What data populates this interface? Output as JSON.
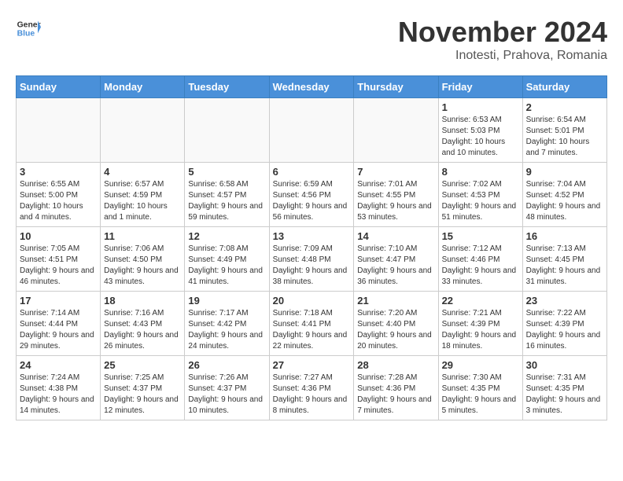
{
  "header": {
    "logo_general": "General",
    "logo_blue": "Blue",
    "month_title": "November 2024",
    "subtitle": "Inotesti, Prahova, Romania"
  },
  "weekdays": [
    "Sunday",
    "Monday",
    "Tuesday",
    "Wednesday",
    "Thursday",
    "Friday",
    "Saturday"
  ],
  "weeks": [
    [
      {
        "day": "",
        "info": ""
      },
      {
        "day": "",
        "info": ""
      },
      {
        "day": "",
        "info": ""
      },
      {
        "day": "",
        "info": ""
      },
      {
        "day": "",
        "info": ""
      },
      {
        "day": "1",
        "info": "Sunrise: 6:53 AM\nSunset: 5:03 PM\nDaylight: 10 hours and 10 minutes."
      },
      {
        "day": "2",
        "info": "Sunrise: 6:54 AM\nSunset: 5:01 PM\nDaylight: 10 hours and 7 minutes."
      }
    ],
    [
      {
        "day": "3",
        "info": "Sunrise: 6:55 AM\nSunset: 5:00 PM\nDaylight: 10 hours and 4 minutes."
      },
      {
        "day": "4",
        "info": "Sunrise: 6:57 AM\nSunset: 4:59 PM\nDaylight: 10 hours and 1 minute."
      },
      {
        "day": "5",
        "info": "Sunrise: 6:58 AM\nSunset: 4:57 PM\nDaylight: 9 hours and 59 minutes."
      },
      {
        "day": "6",
        "info": "Sunrise: 6:59 AM\nSunset: 4:56 PM\nDaylight: 9 hours and 56 minutes."
      },
      {
        "day": "7",
        "info": "Sunrise: 7:01 AM\nSunset: 4:55 PM\nDaylight: 9 hours and 53 minutes."
      },
      {
        "day": "8",
        "info": "Sunrise: 7:02 AM\nSunset: 4:53 PM\nDaylight: 9 hours and 51 minutes."
      },
      {
        "day": "9",
        "info": "Sunrise: 7:04 AM\nSunset: 4:52 PM\nDaylight: 9 hours and 48 minutes."
      }
    ],
    [
      {
        "day": "10",
        "info": "Sunrise: 7:05 AM\nSunset: 4:51 PM\nDaylight: 9 hours and 46 minutes."
      },
      {
        "day": "11",
        "info": "Sunrise: 7:06 AM\nSunset: 4:50 PM\nDaylight: 9 hours and 43 minutes."
      },
      {
        "day": "12",
        "info": "Sunrise: 7:08 AM\nSunset: 4:49 PM\nDaylight: 9 hours and 41 minutes."
      },
      {
        "day": "13",
        "info": "Sunrise: 7:09 AM\nSunset: 4:48 PM\nDaylight: 9 hours and 38 minutes."
      },
      {
        "day": "14",
        "info": "Sunrise: 7:10 AM\nSunset: 4:47 PM\nDaylight: 9 hours and 36 minutes."
      },
      {
        "day": "15",
        "info": "Sunrise: 7:12 AM\nSunset: 4:46 PM\nDaylight: 9 hours and 33 minutes."
      },
      {
        "day": "16",
        "info": "Sunrise: 7:13 AM\nSunset: 4:45 PM\nDaylight: 9 hours and 31 minutes."
      }
    ],
    [
      {
        "day": "17",
        "info": "Sunrise: 7:14 AM\nSunset: 4:44 PM\nDaylight: 9 hours and 29 minutes."
      },
      {
        "day": "18",
        "info": "Sunrise: 7:16 AM\nSunset: 4:43 PM\nDaylight: 9 hours and 26 minutes."
      },
      {
        "day": "19",
        "info": "Sunrise: 7:17 AM\nSunset: 4:42 PM\nDaylight: 9 hours and 24 minutes."
      },
      {
        "day": "20",
        "info": "Sunrise: 7:18 AM\nSunset: 4:41 PM\nDaylight: 9 hours and 22 minutes."
      },
      {
        "day": "21",
        "info": "Sunrise: 7:20 AM\nSunset: 4:40 PM\nDaylight: 9 hours and 20 minutes."
      },
      {
        "day": "22",
        "info": "Sunrise: 7:21 AM\nSunset: 4:39 PM\nDaylight: 9 hours and 18 minutes."
      },
      {
        "day": "23",
        "info": "Sunrise: 7:22 AM\nSunset: 4:39 PM\nDaylight: 9 hours and 16 minutes."
      }
    ],
    [
      {
        "day": "24",
        "info": "Sunrise: 7:24 AM\nSunset: 4:38 PM\nDaylight: 9 hours and 14 minutes."
      },
      {
        "day": "25",
        "info": "Sunrise: 7:25 AM\nSunset: 4:37 PM\nDaylight: 9 hours and 12 minutes."
      },
      {
        "day": "26",
        "info": "Sunrise: 7:26 AM\nSunset: 4:37 PM\nDaylight: 9 hours and 10 minutes."
      },
      {
        "day": "27",
        "info": "Sunrise: 7:27 AM\nSunset: 4:36 PM\nDaylight: 9 hours and 8 minutes."
      },
      {
        "day": "28",
        "info": "Sunrise: 7:28 AM\nSunset: 4:36 PM\nDaylight: 9 hours and 7 minutes."
      },
      {
        "day": "29",
        "info": "Sunrise: 7:30 AM\nSunset: 4:35 PM\nDaylight: 9 hours and 5 minutes."
      },
      {
        "day": "30",
        "info": "Sunrise: 7:31 AM\nSunset: 4:35 PM\nDaylight: 9 hours and 3 minutes."
      }
    ]
  ]
}
